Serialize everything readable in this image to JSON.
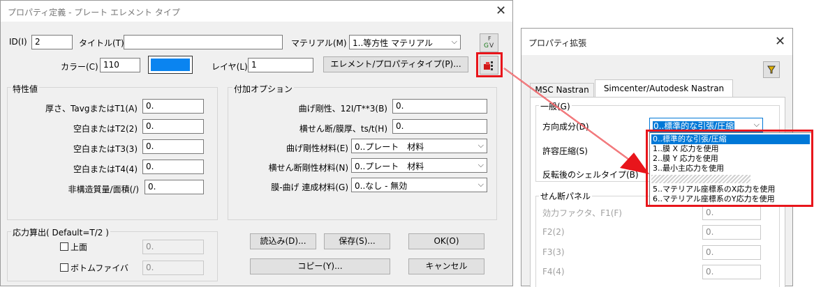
{
  "left_dialog": {
    "title": "プロパティ定義 - プレート エレメント タイプ",
    "id_label": "ID(I)",
    "id_value": "2",
    "title_label": "タイトル(T)",
    "title_value": "",
    "material_label": "マテリアル(M)",
    "material_value": "1..等方性 マテリアル",
    "color_label": "カラー(C)",
    "color_value": "110",
    "color_swatch": "#0a84f0",
    "layer_label": "レイヤ(L)",
    "layer_value": "1",
    "elem_button": "エレメント/プロパティタイプ(P)...",
    "props_group": {
      "title": "特性値",
      "rows": [
        {
          "label": "厚さ、TavgまたはT1(A)",
          "value": "0."
        },
        {
          "label": "空白またはT2(2)",
          "value": "0."
        },
        {
          "label": "空白またはT3(3)",
          "value": "0."
        },
        {
          "label": "空白またはT4(4)",
          "value": "0."
        },
        {
          "label": "非構造質量/面積(/)",
          "value": "0."
        }
      ]
    },
    "options_group": {
      "title": "付加オプション",
      "rows": [
        {
          "label": "曲げ剛性、12I/T**3(B)",
          "value": "0."
        },
        {
          "label": "横せん断/膜厚、ts/t(H)",
          "value": "0."
        }
      ],
      "selects": [
        {
          "label": "曲げ剛性材料(E)",
          "value": "0..プレート　材料"
        },
        {
          "label": "横せん断剛性材料(N)",
          "value": "0..プレート　材料"
        },
        {
          "label": "膜-曲げ 連成材料(G)",
          "value": "0..なし - 無効"
        }
      ]
    },
    "stress_group": {
      "title": "応力算出( Default=T/2 )",
      "top_label": "上面",
      "top_value": "0.",
      "bottom_label": "ボトムファイバ",
      "bottom_value": "0."
    },
    "buttons": {
      "load": "読込み(D)...",
      "save": "保存(S)...",
      "ok": "OK(O)",
      "copy": "コピー(Y)...",
      "cancel": "キャンセル"
    }
  },
  "right_dialog": {
    "title": "プロパティ拡張",
    "tabs": [
      "MSC Nastran",
      "Simcenter/Autodesk Nastran"
    ],
    "general_group": "一般(G)",
    "direction_label": "方向成分(D)",
    "direction_value": "0..標準的な引張/圧縮",
    "compress_label": "許容圧縮(S)",
    "shell_label": "反転後のシェルタイプ(B)",
    "shear_group": "せん断パネル",
    "shear_rows": [
      {
        "label": "効力ファクタ、F1(F)",
        "value": "0."
      },
      {
        "label": "F2(2)",
        "value": "0."
      },
      {
        "label": "F3(3)",
        "value": "0."
      },
      {
        "label": "F4(4)",
        "value": "0."
      }
    ],
    "dropdown_options": [
      "0..標準的な引張/圧縮",
      "1..膜 X 応力を使用",
      "2..膜 Y 応力を使用",
      "3..最小主応力を使用",
      "",
      "5..マテリアル座標系のX応力を使用",
      "6..マテリアル座標系のY応力を使用"
    ]
  },
  "highlight_color": "#e8151b"
}
